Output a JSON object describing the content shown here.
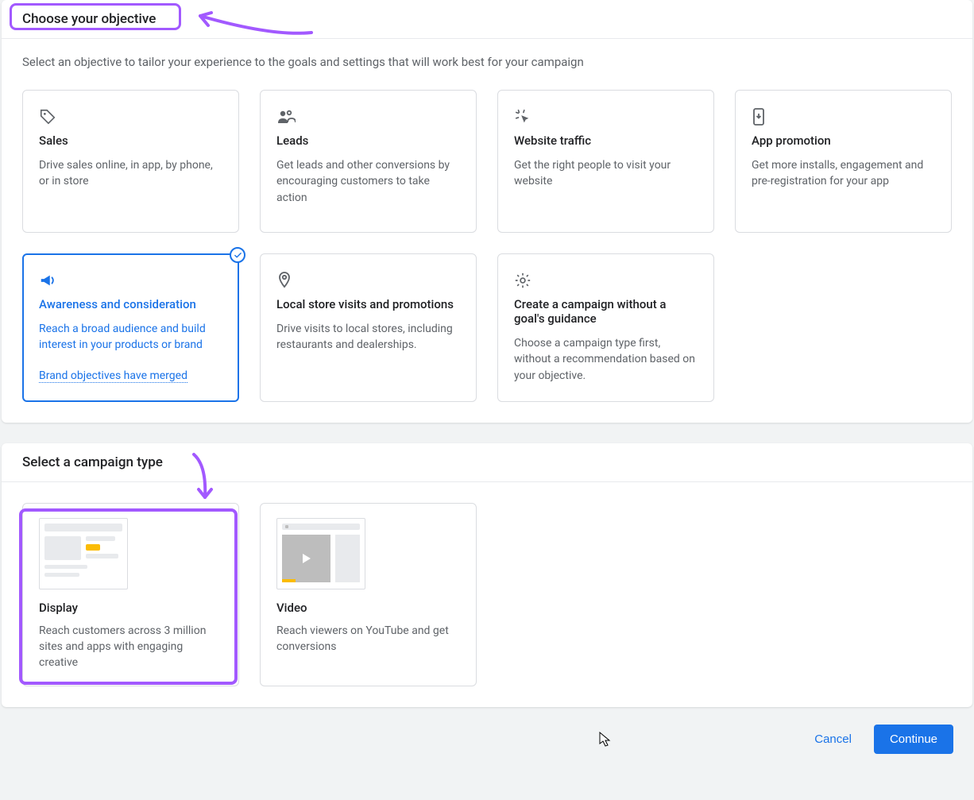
{
  "section1": {
    "header": "Choose your objective",
    "subhead": "Select an objective to tailor your experience to the goals and settings that will work best for your campaign"
  },
  "objectives": [
    {
      "key": "sales",
      "title": "Sales",
      "desc": "Drive sales online, in app, by phone, or in store"
    },
    {
      "key": "leads",
      "title": "Leads",
      "desc": "Get leads and other conversions by encouraging customers to take action"
    },
    {
      "key": "website-traffic",
      "title": "Website traffic",
      "desc": "Get the right people to visit your website"
    },
    {
      "key": "app-promotion",
      "title": "App promotion",
      "desc": "Get more installs, engagement and pre-registration for your app"
    },
    {
      "key": "awareness",
      "title": "Awareness and consideration",
      "desc": "Reach a broad audience and build interest in your products or brand",
      "link": "Brand objectives have merged",
      "selected": true
    },
    {
      "key": "local",
      "title": "Local store visits and promotions",
      "desc": "Drive visits to local stores, including restaurants and dealerships."
    },
    {
      "key": "noguidance",
      "title": "Create a campaign without a goal's guidance",
      "desc": "Choose a campaign type first, without a recommendation based on your objective."
    }
  ],
  "section2": {
    "header": "Select a campaign type"
  },
  "campaign_types": [
    {
      "key": "display",
      "title": "Display",
      "desc": "Reach customers across 3 million sites and apps with engaging creative",
      "highlighted": true
    },
    {
      "key": "video",
      "title": "Video",
      "desc": "Reach viewers on YouTube and get conversions"
    }
  ],
  "footer": {
    "cancel": "Cancel",
    "continue": "Continue"
  },
  "annotation_color": "#a259ff"
}
